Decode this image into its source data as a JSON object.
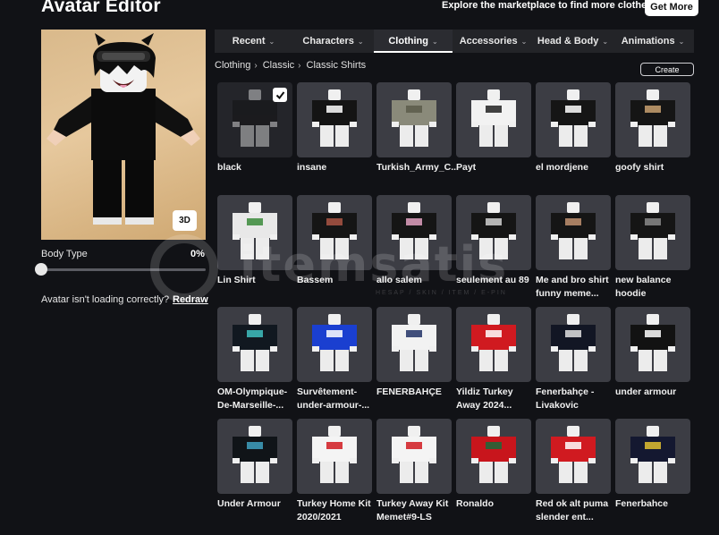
{
  "header": {
    "title": "Avatar Editor",
    "marketplace_text": "Explore the marketplace to find more clothes!",
    "get_more_label": "Get More"
  },
  "preview": {
    "mode_button": "3D",
    "body_type_label": "Body Type",
    "body_type_value": "0%",
    "body_type_level": 0,
    "loading_text": "Avatar isn't loading correctly?",
    "redraw_label": "Redraw"
  },
  "tabs": [
    {
      "label": "Recent",
      "active": false
    },
    {
      "label": "Characters",
      "active": false
    },
    {
      "label": "Clothing",
      "active": true
    },
    {
      "label": "Accessories",
      "active": false
    },
    {
      "label": "Head & Body",
      "active": false
    },
    {
      "label": "Animations",
      "active": false
    }
  ],
  "breadcrumb": [
    "Clothing",
    "Classic",
    "Classic Shirts"
  ],
  "create_label": "Create",
  "watermark": {
    "text": "itemsatis",
    "sub": "HESAP / SKIN / ITEM / E-PIN"
  },
  "colors": {
    "accent": "#ffffff",
    "background": "#111216",
    "card": "#3c3d44"
  },
  "items": [
    {
      "name": "black",
      "selected": true,
      "shirt": "#111111",
      "accent": "#111111"
    },
    {
      "name": "insane",
      "shirt": "#141414",
      "accent": "#ffffff"
    },
    {
      "name": "Turkish_Army_C...",
      "shirt": "#8a8a7a",
      "accent": "#5a5a4a"
    },
    {
      "name": "Payt",
      "shirt": "#f2f2f2",
      "accent": "#222222"
    },
    {
      "name": "el mordjene",
      "shirt": "#151515",
      "accent": "#ffffff"
    },
    {
      "name": "goofy shirt",
      "shirt": "#151515",
      "accent": "#c8a070"
    },
    {
      "name": "Lin Shirt",
      "shirt": "#e8e8e8",
      "accent": "#3a8a3a"
    },
    {
      "name": "Bassem",
      "shirt": "#151515",
      "accent": "#aa5544"
    },
    {
      "name": "allo salem",
      "shirt": "#151515",
      "accent": "#e0a0c0"
    },
    {
      "name": "seulement au 89",
      "shirt": "#151515",
      "accent": "#d0d0d0"
    },
    {
      "name": "Me and bro shirt funny meme...",
      "shirt": "#151515",
      "accent": "#c09070"
    },
    {
      "name": "new balance hoodie",
      "shirt": "#151515",
      "accent": "#888888"
    },
    {
      "name": "OM-Olympique-De-Marseille-...",
      "shirt": "#111820",
      "accent": "#40c0c0"
    },
    {
      "name": "Survêtement-under-armour-...",
      "shirt": "#1a3fd0",
      "accent": "#ffffff"
    },
    {
      "name": "FENERBAHÇE",
      "shirt": "#f2f2f2",
      "accent": "#223366"
    },
    {
      "name": "Yildiz Turkey Away 2024...",
      "shirt": "#d01a20",
      "accent": "#ffffff"
    },
    {
      "name": "Fenerbahçe - Livakovic",
      "shirt": "#121624",
      "accent": "#e0e0e0"
    },
    {
      "name": "under armour",
      "shirt": "#121212",
      "accent": "#ffffff"
    },
    {
      "name": "Under Armour",
      "shirt": "#101418",
      "accent": "#40a0c0"
    },
    {
      "name": "Turkey Home Kit 2020/2021",
      "shirt": "#f4f4f4",
      "accent": "#d01a20"
    },
    {
      "name": "Turkey Away Kit Memet#9-LS",
      "shirt": "#f4f4f4",
      "accent": "#d01a20"
    },
    {
      "name": "Ronaldo",
      "shirt": "#c8151c",
      "accent": "#1a6a3a"
    },
    {
      "name": "Red ok alt puma slender ent...",
      "shirt": "#d01a20",
      "accent": "#ffffff"
    },
    {
      "name": "Fenerbahce",
      "shirt": "#141830",
      "accent": "#e0c030"
    }
  ]
}
